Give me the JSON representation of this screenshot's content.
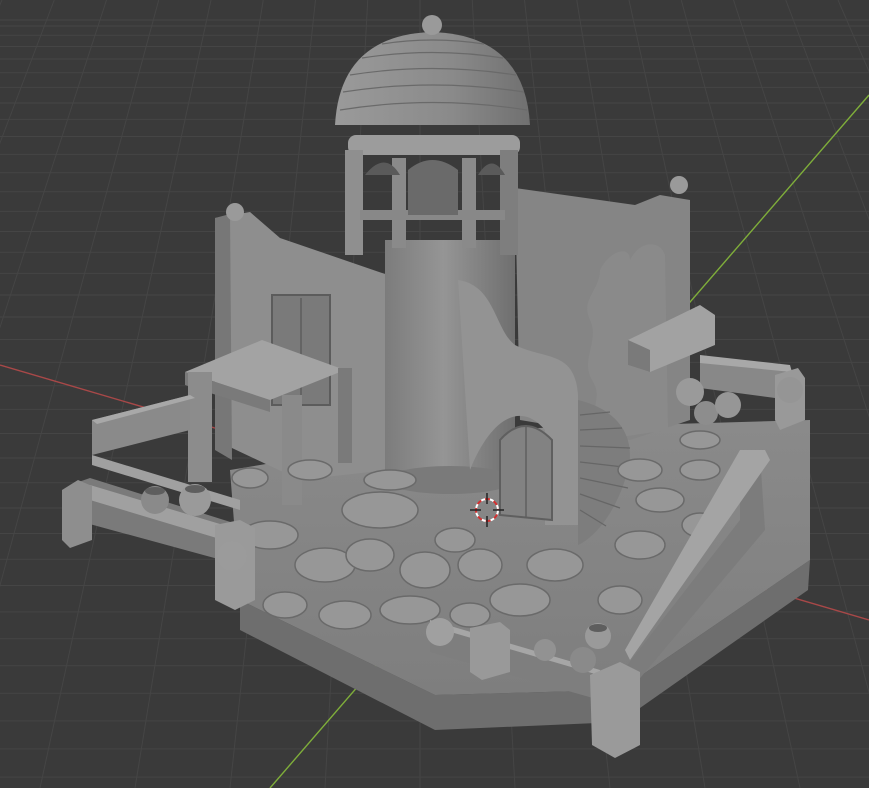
{
  "viewport": {
    "background": "#3a3a3a",
    "grid_color": "#454545",
    "x_axis_color": "#a84848",
    "y_axis_color": "#7fae3a",
    "model_color": "#8c8c8c",
    "model_shadow": "#5f5f5f",
    "model_highlight": "#b2b2b2"
  },
  "objects": {
    "model": "desert-tower-diorama",
    "cursor": "3d-cursor-icon"
  }
}
